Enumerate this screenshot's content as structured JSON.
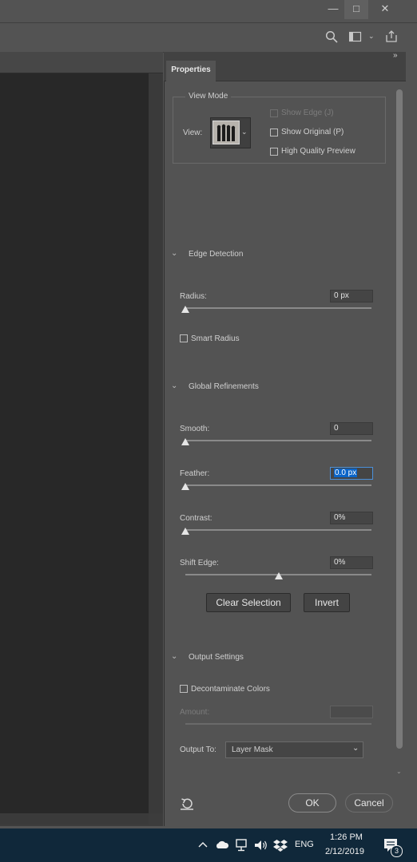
{
  "window": {
    "minimize_icon": "minimize-icon",
    "maximize_icon": "maximize-icon",
    "close_icon": "close-icon"
  },
  "optionsbar": {
    "search_icon": "search-icon",
    "workspace_icon": "workspace-icon",
    "share_icon": "share-icon"
  },
  "panel": {
    "tab_label": "Properties",
    "collapse_label": "»",
    "view_mode": {
      "legend": "View Mode",
      "view_label": "View:",
      "show_edge": "Show Edge (J)",
      "show_original": "Show Original (P)",
      "high_quality": "High Quality Preview"
    },
    "edge_detection": {
      "title": "Edge Detection",
      "radius_label": "Radius:",
      "radius_value": "0 px",
      "radius_level": 0,
      "smart_radius": "Smart Radius"
    },
    "global": {
      "title": "Global Refinements",
      "smooth_label": "Smooth:",
      "smooth_value": "0",
      "smooth_level": 0,
      "feather_label": "Feather:",
      "feather_value": "0.0 px",
      "feather_level": 0,
      "contrast_label": "Contrast:",
      "contrast_value": "0%",
      "contrast_level": 0,
      "shift_label": "Shift Edge:",
      "shift_value": "0%",
      "shift_level": 0.5,
      "clear_selection": "Clear Selection",
      "invert": "Invert"
    },
    "output": {
      "title": "Output Settings",
      "decontaminate": "Decontaminate Colors",
      "amount_label": "Amount:",
      "amount_value": "",
      "output_to_label": "Output To:",
      "output_to_value": "Layer Mask"
    },
    "ok": "OK",
    "cancel": "Cancel"
  },
  "taskbar": {
    "language": "ENG",
    "time": "1:26 PM",
    "date": "2/12/2019",
    "notification_count": "3"
  },
  "colors": {
    "panel_bg": "#535353",
    "canvas_bg": "#282828",
    "taskbar_bg": "#10283a",
    "highlight": "#0a64c8"
  }
}
